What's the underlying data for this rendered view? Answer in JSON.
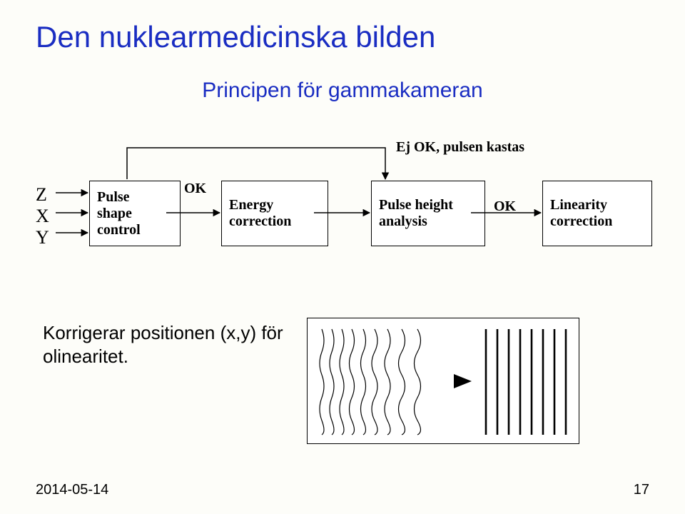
{
  "title": "Den nuklearmedicinska bilden",
  "subtitle": "Principen för gammakameran",
  "reject_label": "Ej OK, pulsen kastas",
  "inputs": {
    "z": "Z",
    "x": "X",
    "y": "Y"
  },
  "ok_label_1": "OK",
  "ok_label_2": "OK",
  "boxes": {
    "pulse_shape_control": "Pulse\nshape\ncontrol",
    "energy_correction": "Energy\ncorrection",
    "pulse_height_analysis": "Pulse height\nanalysis",
    "linearity_correction": "Linearity\ncorrection"
  },
  "caption": "Korrigerar positionen (x,y) för\nolinearitet.",
  "footer": {
    "date": "2014-05-14",
    "page": "17"
  }
}
